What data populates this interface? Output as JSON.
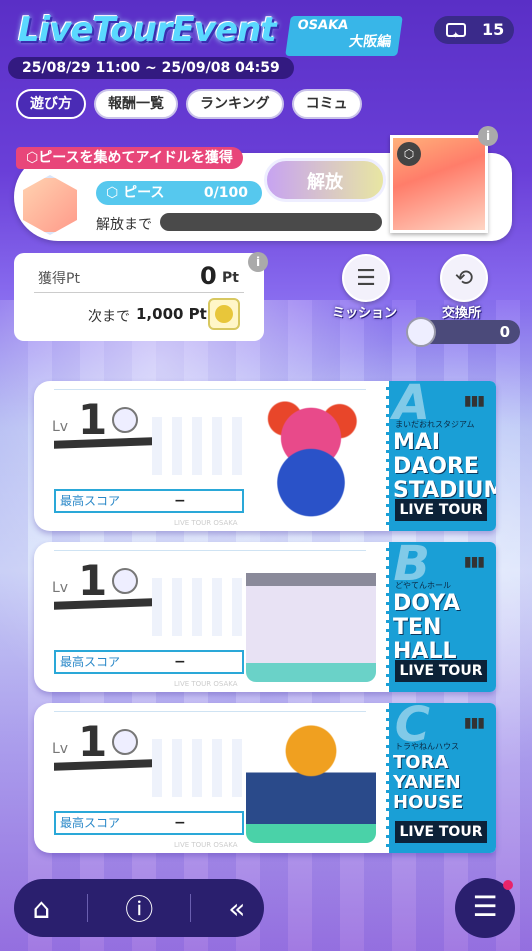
{
  "header": {
    "title": "LiveTourEvent",
    "area_en": "OSAKA",
    "area_ja": "大阪編",
    "period": "25/08/29 11:00 ~ 25/09/08 04:59",
    "tickets": "15"
  },
  "tabs": [
    {
      "label": "遊び方",
      "active": true
    },
    {
      "label": "報酬一覧"
    },
    {
      "label": "ランキング"
    },
    {
      "label": "コミュ"
    }
  ],
  "piece": {
    "heading": "ピースを集めてアイドルを獲得",
    "label": "ピース",
    "count": "0/100",
    "unlock_label": "解放まで",
    "unlock_button": "解放"
  },
  "points": {
    "label": "獲得Pt",
    "value": "0",
    "unit": "Pt",
    "next_label": "次まで",
    "next_value": "1,000 Pt"
  },
  "actions": {
    "mission": "ミッション",
    "exchange": "交換所",
    "item_count": "0"
  },
  "venues": [
    {
      "letter": "A",
      "sub": "まいだおれスタジアム",
      "name": "MAI DAORE STADIUM",
      "lv_label": "Lv",
      "level": "1",
      "score_label": "最高スコア",
      "score": "−",
      "tour": "LIVE TOUR",
      "footer": "LIVE TOUR OSAKA"
    },
    {
      "letter": "B",
      "sub": "どやてんホール",
      "name": "DOYA TEN HALL",
      "lv_label": "Lv",
      "level": "1",
      "score_label": "最高スコア",
      "score": "−",
      "tour": "LIVE TOUR",
      "footer": "LIVE TOUR OSAKA"
    },
    {
      "letter": "C",
      "sub": "トラやねんハウス",
      "name": "TORA YANEN HOUSE",
      "lv_label": "Lv",
      "level": "1",
      "score_label": "最高スコア",
      "score": "−",
      "tour": "LIVE TOUR",
      "footer": "LIVE TOUR OSAKA"
    }
  ],
  "colors": {
    "accent": "#4a2bb5",
    "piece_head": "#e8467a",
    "stub": "#1a9fd6"
  },
  "icons": {
    "home": "home-icon",
    "help": "help-icon",
    "back": "back-icon",
    "menu": "menu-icon"
  }
}
